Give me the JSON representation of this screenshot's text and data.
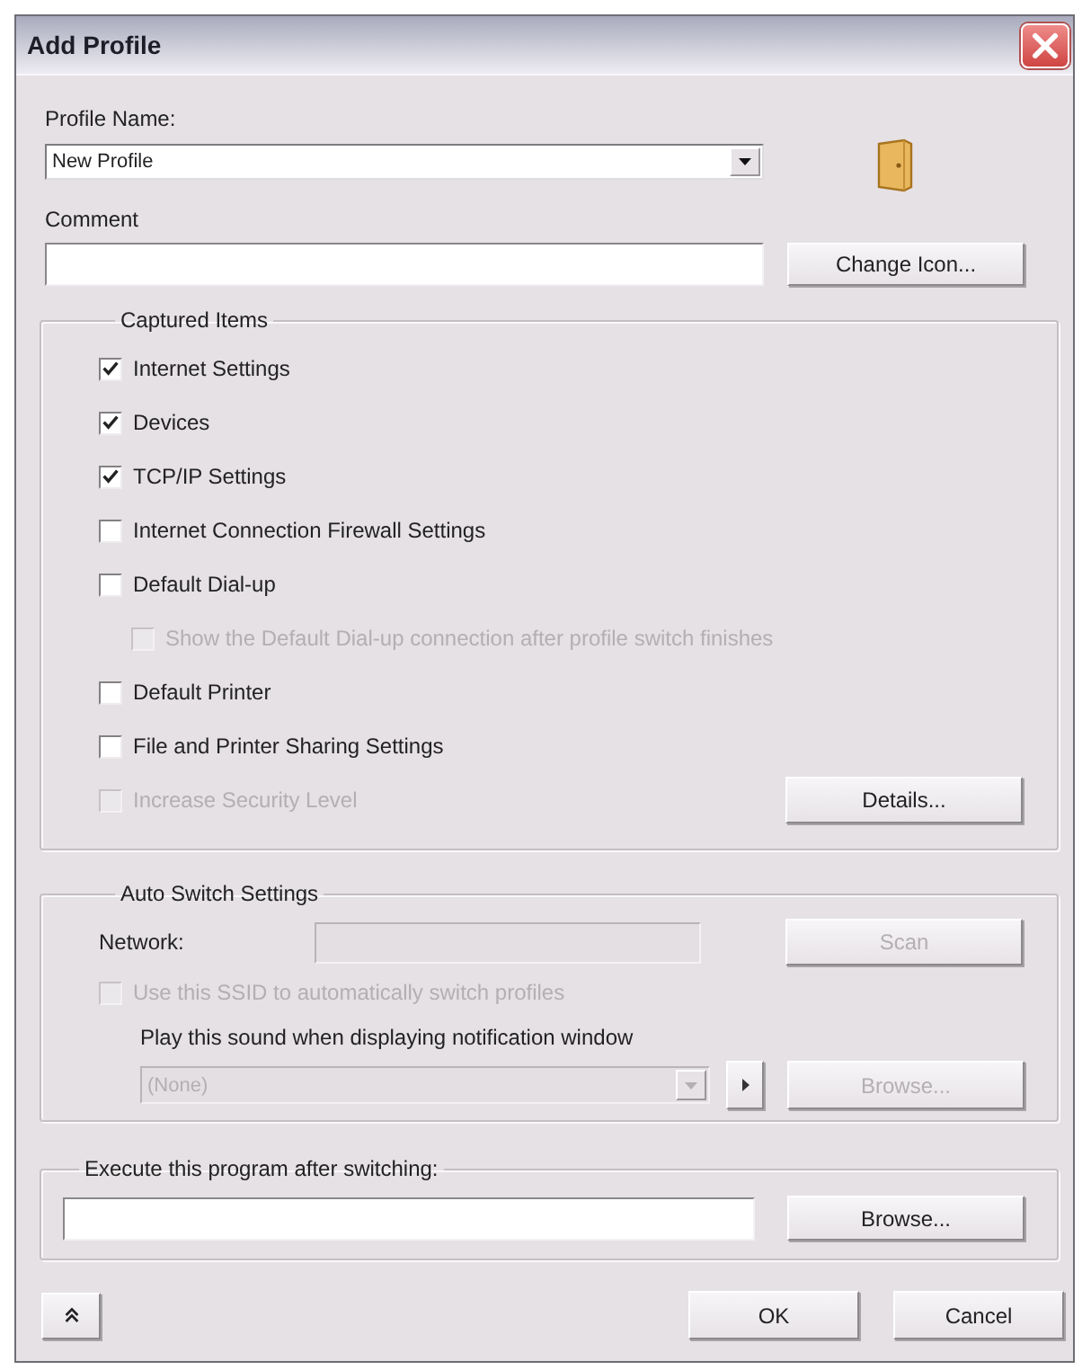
{
  "window": {
    "title": "Add Profile"
  },
  "profile_name": {
    "label": "Profile Name:",
    "value": "New Profile"
  },
  "comment": {
    "label": "Comment"
  },
  "change_icon_button": {
    "label": "Change Icon..."
  },
  "captured_items": {
    "title": "Captured Items",
    "items": [
      {
        "label": "Internet Settings",
        "checked": true,
        "disabled": false
      },
      {
        "label": "Devices",
        "checked": true,
        "disabled": false
      },
      {
        "label": "TCP/IP Settings",
        "checked": true,
        "disabled": false
      },
      {
        "label": "Internet Connection Firewall Settings",
        "checked": false,
        "disabled": false
      },
      {
        "label": "Default Dial-up",
        "checked": false,
        "disabled": false,
        "children": [
          {
            "label": "Show the Default Dial-up connection after profile switch finishes",
            "checked": false,
            "disabled": true
          }
        ]
      },
      {
        "label": "Default Printer",
        "checked": false,
        "disabled": false
      },
      {
        "label": "File and Printer Sharing Settings",
        "checked": false,
        "disabled": false
      },
      {
        "label": "Increase Security Level",
        "checked": false,
        "disabled": true
      }
    ],
    "details_button": {
      "label": "Details...",
      "disabled": false
    }
  },
  "auto_switch": {
    "title": "Auto Switch Settings",
    "network": {
      "label": "Network:",
      "disabled": true
    },
    "scan_button": {
      "label": "Scan",
      "disabled": true
    },
    "ssid_checkbox": {
      "label": "Use this SSID to automatically switch profiles",
      "checked": false,
      "disabled": true
    },
    "sound": {
      "label": "Play this sound when displaying notification window",
      "value": "(None)",
      "disabled": true
    },
    "play_button": {
      "disabled": false
    },
    "browse_button": {
      "label": "Browse...",
      "disabled": true
    }
  },
  "execute": {
    "title": "Execute this program after switching:",
    "browse_button": {
      "label": "Browse...",
      "disabled": false
    }
  },
  "footer": {
    "ok_button": {
      "label": "OK"
    },
    "cancel_button": {
      "label": "Cancel"
    }
  }
}
